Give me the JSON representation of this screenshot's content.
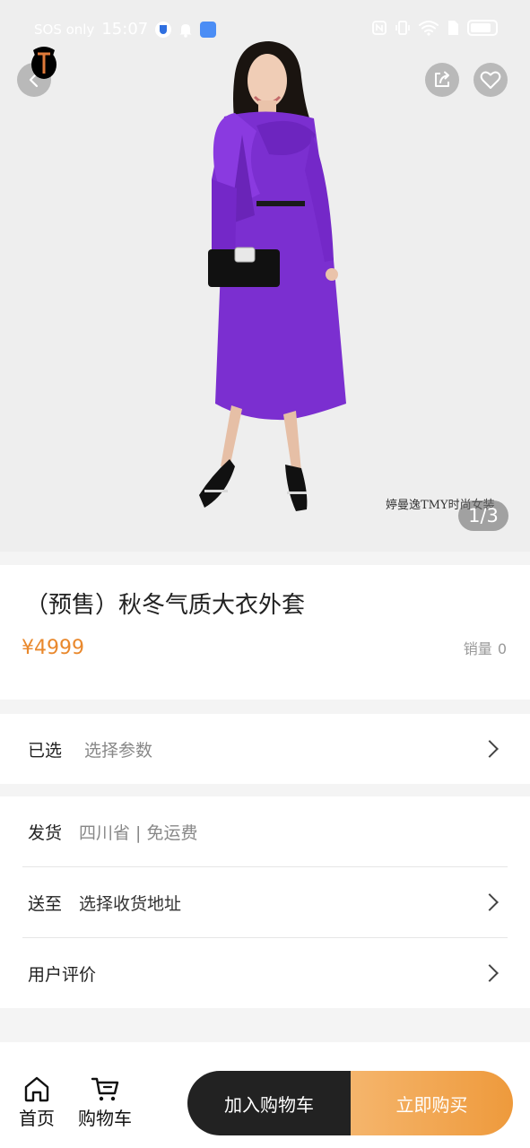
{
  "status": {
    "carrier": "SOS only",
    "time": "15:07"
  },
  "hero": {
    "watermark": "婷曼逸TMY时尚女装",
    "pager": "1/3",
    "back_icon": "chevron-left-icon",
    "share_icon": "share-icon",
    "fav_icon": "heart-icon"
  },
  "product": {
    "title": "（预售）秋冬气质大衣外套",
    "price": "¥4999",
    "sales_label": "销量",
    "sales_count": "0"
  },
  "selected": {
    "label": "已选",
    "value": "选择参数"
  },
  "shipping": {
    "label": "发货",
    "value": "四川省 | 免运费"
  },
  "deliver": {
    "label": "送至",
    "value": "选择收货地址"
  },
  "reviews": {
    "label": "用户评价"
  },
  "bottom": {
    "home_label": "首页",
    "cart_label": "购物车",
    "add_to_cart": "加入购物车",
    "buy_now": "立即购买"
  },
  "colors": {
    "accent": "#e9882c",
    "dark": "#222222",
    "coat": "#7b2fd0"
  }
}
